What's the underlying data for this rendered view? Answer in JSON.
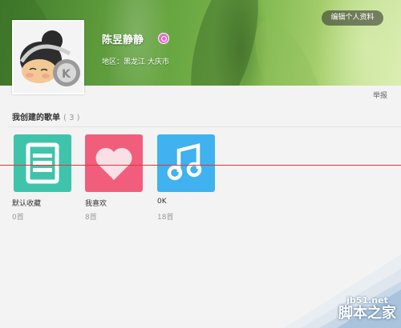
{
  "header": {
    "edit_profile_label": "编辑个人资料",
    "username": "陈昱静静",
    "region_label": "地区：",
    "region_value": "黑龙江 大庆市",
    "gender_icon": "female-icon",
    "gender_color": "#e56dc6"
  },
  "report_label": "举报",
  "playlists": {
    "title": "我创建的歌单",
    "count": "( 3 )",
    "items": [
      {
        "name": "默认收藏",
        "count": "0首",
        "icon": "list-icon",
        "color": "#3fc4ab"
      },
      {
        "name": "我喜欢",
        "count": "8首",
        "icon": "heart-icon",
        "color": "#f15e7c"
      },
      {
        "name": "0K",
        "count": "18首",
        "icon": "music-note-icon",
        "color": "#3fb2ef"
      }
    ]
  },
  "watermark": {
    "url": "jb51.net",
    "text": "脚本之家"
  }
}
